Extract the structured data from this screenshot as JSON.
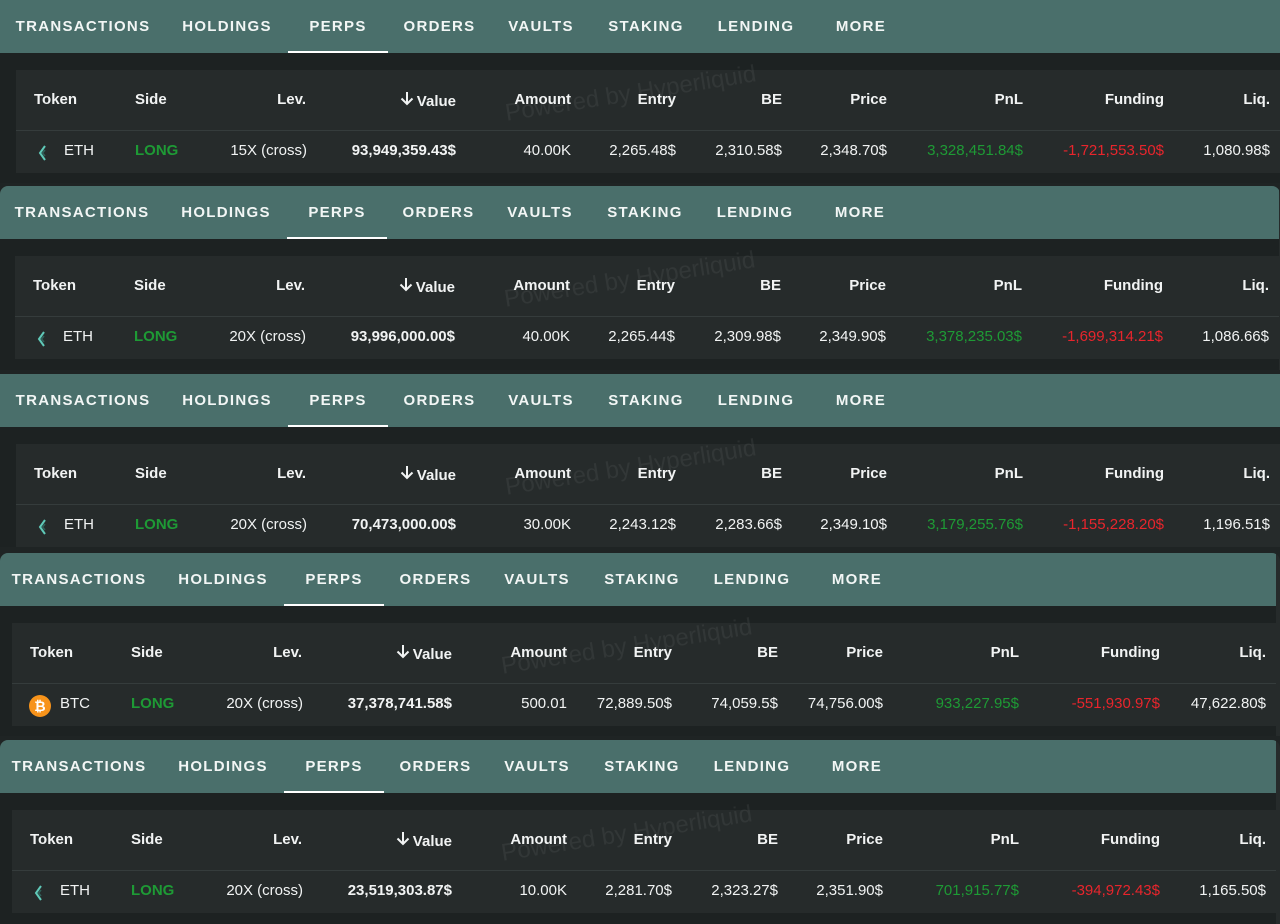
{
  "tabs": [
    "TRANSACTIONS",
    "HOLDINGS",
    "PERPS",
    "ORDERS",
    "VAULTS",
    "STAKING",
    "LENDING",
    "MORE"
  ],
  "active_tab": "PERPS",
  "headers": {
    "token": "Token",
    "side": "Side",
    "lev": "Lev.",
    "value": "Value",
    "amount": "Amount",
    "entry": "Entry",
    "be": "BE",
    "price": "Price",
    "pnl": "PnL",
    "funding": "Funding",
    "liq": "Liq."
  },
  "value_sort_icon": "arrow-down-icon",
  "watermark": "Powered by Hyperliquid",
  "colors": {
    "tab_bar": "#4a6f6b",
    "positive": "#1e9a35",
    "negative": "#e8252c",
    "btc": "#f7931a"
  },
  "snapshots": [
    {
      "token": "ETH",
      "token_icon": "eth-icon",
      "side": "LONG",
      "lev": "15X (cross)",
      "value": "93,949,359.43$",
      "amount": "40.00K",
      "entry": "2,265.48$",
      "be": "2,310.58$",
      "price": "2,348.70$",
      "pnl": "3,328,451.84$",
      "funding": "-1,721,553.50$",
      "liq": "1,080.98$"
    },
    {
      "token": "ETH",
      "token_icon": "eth-icon",
      "side": "LONG",
      "lev": "20X (cross)",
      "value": "93,996,000.00$",
      "amount": "40.00K",
      "entry": "2,265.44$",
      "be": "2,309.98$",
      "price": "2,349.90$",
      "pnl": "3,378,235.03$",
      "funding": "-1,699,314.21$",
      "liq": "1,086.66$"
    },
    {
      "token": "ETH",
      "token_icon": "eth-icon",
      "side": "LONG",
      "lev": "20X (cross)",
      "value": "70,473,000.00$",
      "amount": "30.00K",
      "entry": "2,243.12$",
      "be": "2,283.66$",
      "price": "2,349.10$",
      "pnl": "3,179,255.76$",
      "funding": "-1,155,228.20$",
      "liq": "1,196.51$"
    },
    {
      "token": "BTC",
      "token_icon": "btc-icon",
      "btc_symbol": "₿",
      "side": "LONG",
      "lev": "20X (cross)",
      "value": "37,378,741.58$",
      "amount": "500.01",
      "entry": "72,889.50$",
      "be": "74,059.5$",
      "price": "74,756.00$",
      "pnl": "933,227.95$",
      "funding": "-551,930.97$",
      "liq": "47,622.80$"
    },
    {
      "token": "ETH",
      "token_icon": "eth-icon",
      "side": "LONG",
      "lev": "20X (cross)",
      "value": "23,519,303.87$",
      "amount": "10.00K",
      "entry": "2,281.70$",
      "be": "2,323.27$",
      "price": "2,351.90$",
      "pnl": "701,915.77$",
      "funding": "-394,972.43$",
      "liq": "1,165.50$"
    }
  ]
}
